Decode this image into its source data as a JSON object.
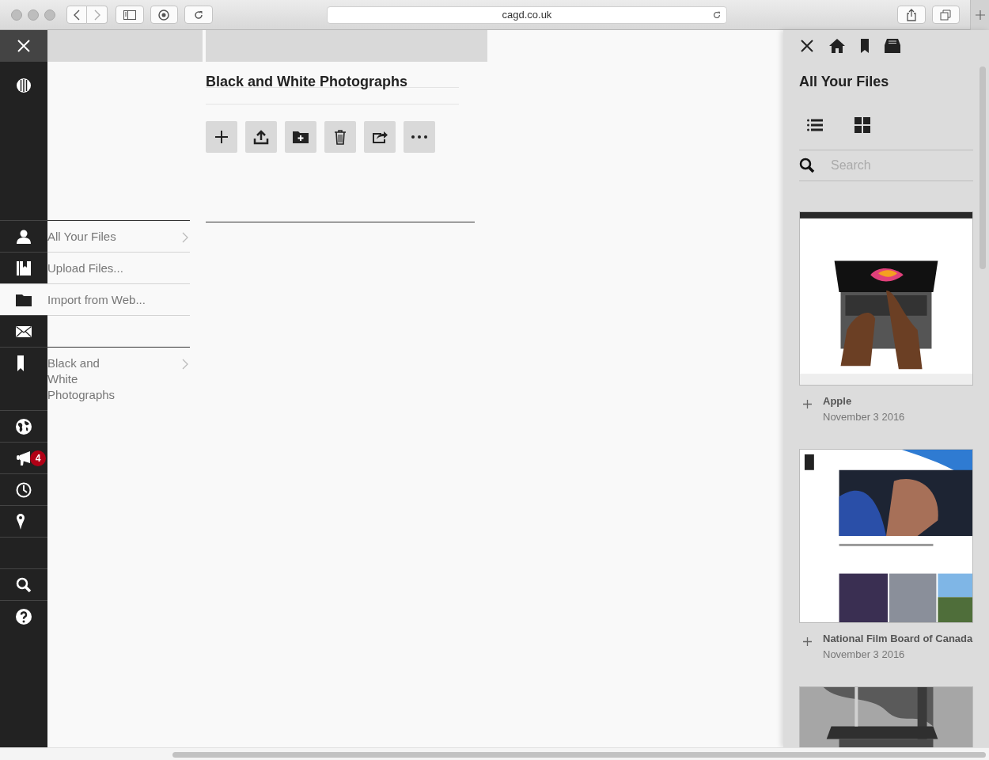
{
  "browser": {
    "url": "cagd.co.uk"
  },
  "sidebar": {
    "badge": "4"
  },
  "menu": [
    {
      "label": "All Your Files",
      "selected": false,
      "arrow": true
    },
    {
      "label": "Upload Files...",
      "selected": false,
      "arrow": false
    },
    {
      "label": "Import from Web...",
      "selected": true,
      "arrow": false
    },
    {
      "label": "Black and White Photographs",
      "selected": false,
      "arrow": true
    }
  ],
  "folder": {
    "title": "Black and White Photographs"
  },
  "panel": {
    "title": "All Your Files",
    "search": {
      "placeholder": "Search"
    },
    "files": [
      {
        "kind": "picture",
        "title": "Apple",
        "date": "November 3 2016"
      },
      {
        "kind": "picture",
        "title": "National Film Board of Canada",
        "date": "November 3 2016"
      },
      {
        "kind": "picture"
      }
    ]
  }
}
